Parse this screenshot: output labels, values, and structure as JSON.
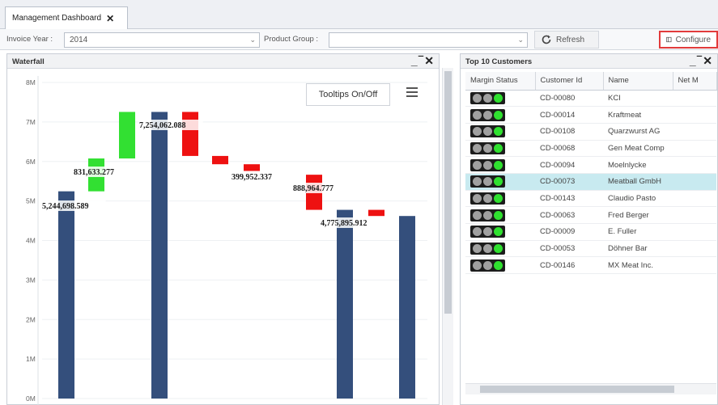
{
  "tab": {
    "label": "Management Dashboard",
    "close": "✕"
  },
  "filters": {
    "invoice_year_label": "Invoice Year :",
    "invoice_year_value": "2014",
    "product_group_label": "Product Group :",
    "product_group_value": ""
  },
  "toolbar": {
    "refresh_label": "Refresh",
    "configure_label": "Configure"
  },
  "waterfall": {
    "title": "Waterfall",
    "controls": "_‾✕",
    "tooltips_button": "Tooltips On/Off",
    "menu_icon": "hamburger-icon"
  },
  "chart_data": {
    "type": "bar",
    "subtype": "waterfall",
    "y_ticks": [
      "8M",
      "7M",
      "6M",
      "5M",
      "4M",
      "3M",
      "2M",
      "1M",
      "0M"
    ],
    "ylim": [
      0,
      8000000
    ],
    "legend": "none",
    "colors": {
      "total": "#344f7c",
      "increase": "#32e032",
      "decrease": "#ee1111"
    },
    "bars": [
      {
        "kind": "total",
        "start": 0,
        "end": 5244698.589
      },
      {
        "kind": "increase",
        "start": 5244698.589,
        "end": 6076331.866
      },
      {
        "kind": "increase",
        "start": 6076331.866,
        "end": 7254062.088
      },
      {
        "kind": "total",
        "start": 0,
        "end": 7254062.088
      },
      {
        "kind": "decrease",
        "start": 7254062.088,
        "end": 6140000
      },
      {
        "kind": "decrease",
        "start": 6140000,
        "end": 5930000
      },
      {
        "kind": "decrease",
        "start": 5930000,
        "end": 5760000
      },
      {
        "kind": "decrease",
        "start": 5664860.689,
        "end": 4775895.912
      },
      {
        "kind": "total",
        "start": 0,
        "end": 4775895.912
      },
      {
        "kind": "decrease",
        "start": 4775895.912,
        "end": 4620000
      },
      {
        "kind": "total",
        "start": 0,
        "end": 4620000
      }
    ],
    "data_labels": [
      {
        "text": "5,244,698.589",
        "bar": 0
      },
      {
        "text": "831,633.277",
        "bar": 1
      },
      {
        "text": "7,254,062.088",
        "bar": 3
      },
      {
        "text": "399,952.337",
        "bar": 5
      },
      {
        "text": "888,964.777",
        "bar": 7
      },
      {
        "text": "4,775,895.912",
        "bar": 8
      }
    ]
  },
  "customers": {
    "title": "Top 10 Customers",
    "controls": "_‾✕",
    "columns": [
      "Margin Status",
      "Customer Id",
      "Name",
      "Net M"
    ],
    "rows": [
      {
        "id": "CD-00080",
        "name": "KCI"
      },
      {
        "id": "CD-00014",
        "name": "Kraftmeat"
      },
      {
        "id": "CD-00108",
        "name": "Quarzwurst AG"
      },
      {
        "id": "CD-00068",
        "name": "Gen Meat Comp"
      },
      {
        "id": "CD-00094",
        "name": "Moelnlycke"
      },
      {
        "id": "CD-00073",
        "name": "Meatball GmbH"
      },
      {
        "id": "CD-00143",
        "name": "Claudio Pasto"
      },
      {
        "id": "CD-00063",
        "name": "Fred Berger"
      },
      {
        "id": "CD-00009",
        "name": "E. Fuller"
      },
      {
        "id": "CD-00053",
        "name": "Döhner Bar"
      },
      {
        "id": "CD-00146",
        "name": "MX Meat Inc."
      }
    ],
    "selected_row": 5,
    "status_colors": {
      "off": "#a0a0a0",
      "on": "#2fe02f"
    }
  }
}
